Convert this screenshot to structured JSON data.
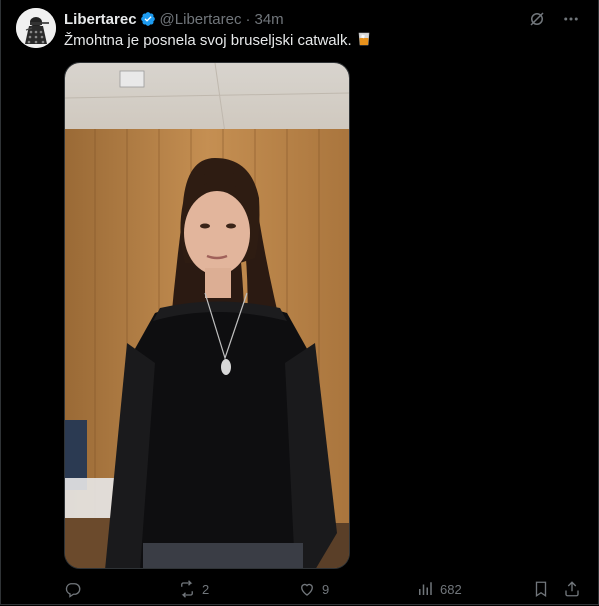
{
  "tweet": {
    "author_name": "Libertarec",
    "handle": "@Libertarec",
    "separator": "·",
    "time": "34m",
    "text": "Žmohtna je posnela svoj bruseljski catwalk.",
    "verified": true,
    "media_type": "video"
  },
  "icons": {
    "avatar": "dalek-avatar",
    "verified": "verified-badge-icon",
    "grok": "grok-icon",
    "more": "more-icon",
    "emoji": "whisky-glass-emoji"
  },
  "actions": {
    "reply_count": "",
    "retweet_count": "2",
    "like_count": "9",
    "view_count": "682"
  },
  "colors": {
    "background": "#000000",
    "text_primary": "#e7e9ea",
    "text_secondary": "#71767b",
    "verified": "#1d9bf0",
    "border": "#2f3336"
  }
}
